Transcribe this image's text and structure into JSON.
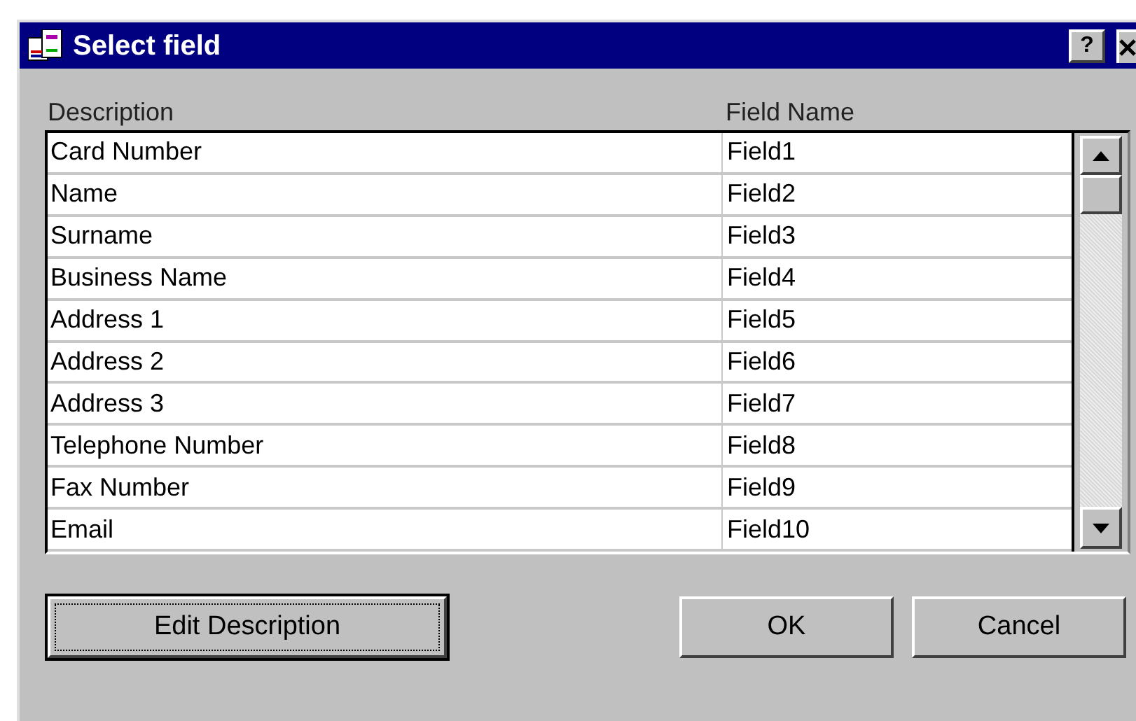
{
  "window": {
    "title": "Select field",
    "help_button": "?"
  },
  "table": {
    "columns": [
      "Description",
      "Field Name"
    ],
    "rows": [
      {
        "description": "Card Number",
        "field_name": "Field1"
      },
      {
        "description": "Name",
        "field_name": "Field2"
      },
      {
        "description": "Surname",
        "field_name": "Field3"
      },
      {
        "description": "Business Name",
        "field_name": "Field4"
      },
      {
        "description": "Address 1",
        "field_name": "Field5"
      },
      {
        "description": "Address 2",
        "field_name": "Field6"
      },
      {
        "description": "Address 3",
        "field_name": "Field7"
      },
      {
        "description": "Telephone Number",
        "field_name": "Field8"
      },
      {
        "description": "Fax Number",
        "field_name": "Field9"
      },
      {
        "description": "Email",
        "field_name": "Field10"
      }
    ]
  },
  "buttons": [
    {
      "label": "Edit Description",
      "focused": true
    },
    {
      "label": "OK",
      "focused": false
    },
    {
      "label": "Cancel",
      "focused": false
    }
  ]
}
